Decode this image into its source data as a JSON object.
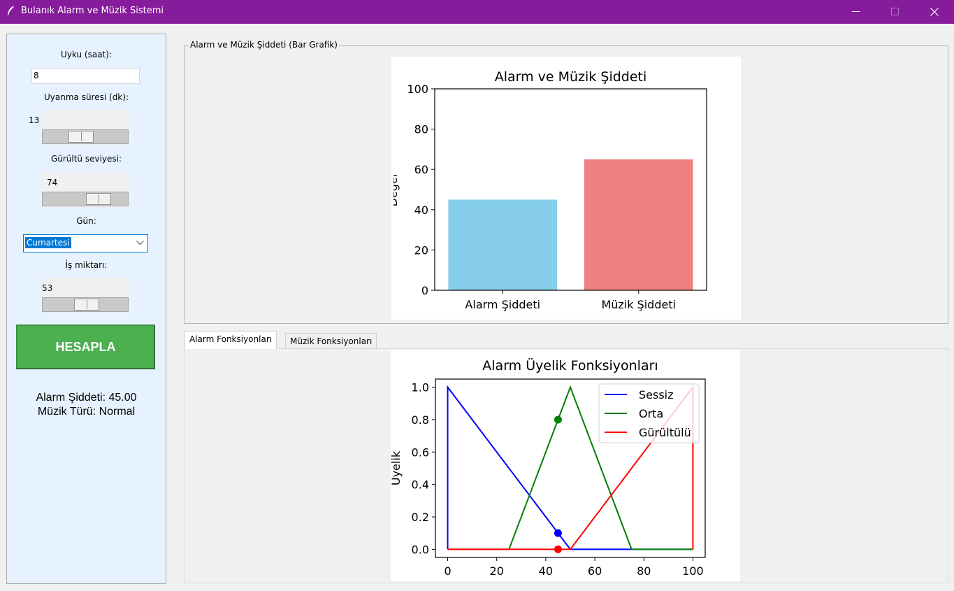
{
  "window": {
    "title": "Bulanık Alarm ve Müzik Sistemi"
  },
  "left_panel": {
    "sleep_label": "Uyku (saat):",
    "sleep_value": "8",
    "wake_label": "Uyanma süresi (dk):",
    "wake_value": "13",
    "noise_label": "Gürültü seviyesi:",
    "noise_value": "74",
    "day_label": "Gün:",
    "day_value": "Cumartesi",
    "work_label": "İş miktarı:",
    "work_value": "53",
    "calc_button": "HESAPLA",
    "result_alarm": "Alarm Şiddeti: 45.00",
    "result_music": "Müzik Türü: Normal"
  },
  "bar_frame": {
    "title": "Alarm ve Müzik Şiddeti (Bar Grafik)"
  },
  "tabs": [
    {
      "label": "Alarm Fonksiyonları",
      "active": true
    },
    {
      "label": "Müzik Fonksiyonları",
      "active": false
    }
  ],
  "chart_data": [
    {
      "type": "bar",
      "title": "Alarm ve Müzik Şiddeti",
      "ylabel": "Değer",
      "categories": [
        "Alarm Şiddeti",
        "Müzik Şiddeti"
      ],
      "values": [
        45,
        65
      ],
      "colors": [
        "#87ceeb",
        "#f08080"
      ],
      "ylim": [
        0,
        100
      ],
      "yticks": [
        0,
        20,
        40,
        60,
        80,
        100
      ]
    },
    {
      "type": "line",
      "title": "Alarm Üyelik Fonksiyonları",
      "ylabel": "Üyelik",
      "xlim": [
        0,
        100
      ],
      "ylim": [
        0,
        1
      ],
      "xticks": [
        0,
        20,
        40,
        60,
        80,
        100
      ],
      "yticks": [
        "0.0",
        "0.2",
        "0.4",
        "0.6",
        "0.8",
        "1.0"
      ],
      "legend": "top-right",
      "series": [
        {
          "name": "Sessiz",
          "color": "#0000ff",
          "x": [
            0,
            0,
            50,
            100
          ],
          "y": [
            0,
            1,
            0,
            0
          ]
        },
        {
          "name": "Orta",
          "color": "#008000",
          "x": [
            0,
            25,
            50,
            75,
            100
          ],
          "y": [
            0,
            0,
            1,
            0,
            0
          ]
        },
        {
          "name": "Gürültülü",
          "color": "#ff0000",
          "x": [
            0,
            50,
            100,
            100
          ],
          "y": [
            0,
            0,
            1,
            0
          ]
        }
      ],
      "markers": [
        {
          "x": 45,
          "y": 0.1,
          "color": "#0000ff"
        },
        {
          "x": 45,
          "y": 0.8,
          "color": "#008000"
        },
        {
          "x": 45,
          "y": 0.0,
          "color": "#ff0000"
        }
      ]
    }
  ]
}
